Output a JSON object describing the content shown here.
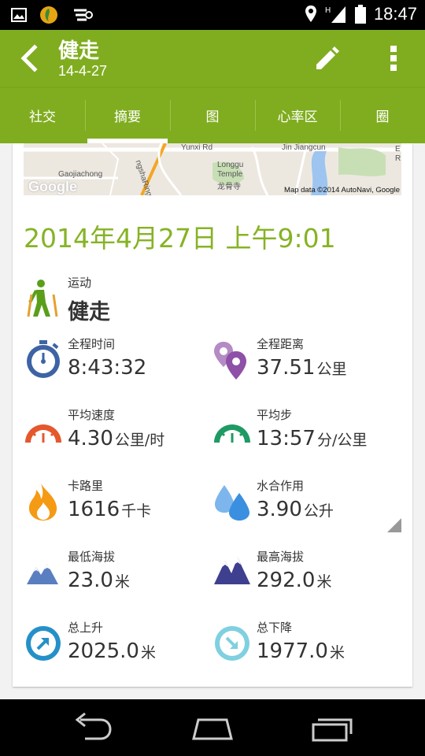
{
  "status_bar": {
    "time": "18:47",
    "icons": [
      "image-icon",
      "app-icon",
      "notification-icon",
      "location-icon",
      "signal-icon",
      "battery-icon"
    ],
    "signal_label": "H"
  },
  "app_bar": {
    "title": "健走",
    "subtitle": "14-4-27",
    "color": "#80ad20"
  },
  "tabs": [
    {
      "label": "社交"
    },
    {
      "label": "摘要",
      "active": true
    },
    {
      "label": "图"
    },
    {
      "label": "心率区"
    },
    {
      "label": "圈"
    }
  ],
  "map": {
    "labels": [
      "Yunxi Rd",
      "Jin Jiangcun",
      "Gaojiachong",
      "Longgu",
      "Temple",
      "龙骨寺",
      "ngshaRing",
      "E",
      "R"
    ],
    "logo": "Google",
    "credit": "Map data ©2014 AutoNavi, Google"
  },
  "date_time": "2014年4月27日 上午9:01",
  "activity": {
    "label": "运动",
    "value": "健走"
  },
  "stats": [
    {
      "label": "全程时间",
      "value": "8:43:32",
      "unit": "",
      "icon": "stopwatch-icon"
    },
    {
      "label": "全程距离",
      "value": "37.51",
      "unit": "公里",
      "icon": "map-pin-icon"
    },
    {
      "label": "平均速度",
      "value": "4.30",
      "unit": "公里/时",
      "icon": "speedometer-icon"
    },
    {
      "label": "平均步",
      "value": "13:57",
      "unit": "分/公里",
      "icon": "pace-gauge-icon"
    },
    {
      "label": "卡路里",
      "value": "1616",
      "unit": "千卡",
      "icon": "flame-icon"
    },
    {
      "label": "水合作用",
      "value": "3.90",
      "unit": "公升",
      "icon": "water-drops-icon"
    },
    {
      "label": "最低海拔",
      "value": "23.0",
      "unit": "米",
      "icon": "low-mountain-icon"
    },
    {
      "label": "最高海拔",
      "value": "292.0",
      "unit": "米",
      "icon": "high-mountain-icon"
    },
    {
      "label": "总上升",
      "value": "2025.0",
      "unit": "米",
      "icon": "ascent-arrow-icon"
    },
    {
      "label": "总下降",
      "value": "1977.0",
      "unit": "米",
      "icon": "descent-arrow-icon"
    }
  ],
  "colors": {
    "accent_green": "#80ad20",
    "date_green": "#86b325",
    "blue": "#3d63a5",
    "purple": "#8e51a7",
    "orange": "#e5582b",
    "teal": "#1e9a64",
    "fire": "#f59a15",
    "water": "#3a8fe0",
    "mountain_low": "#5a7fc0",
    "mountain_high": "#3f3f90",
    "ascent": "#2590c8",
    "descent": "#7fd0e0"
  },
  "nav_bar": [
    "back-nav-icon",
    "home-nav-icon",
    "recent-apps-nav-icon"
  ]
}
